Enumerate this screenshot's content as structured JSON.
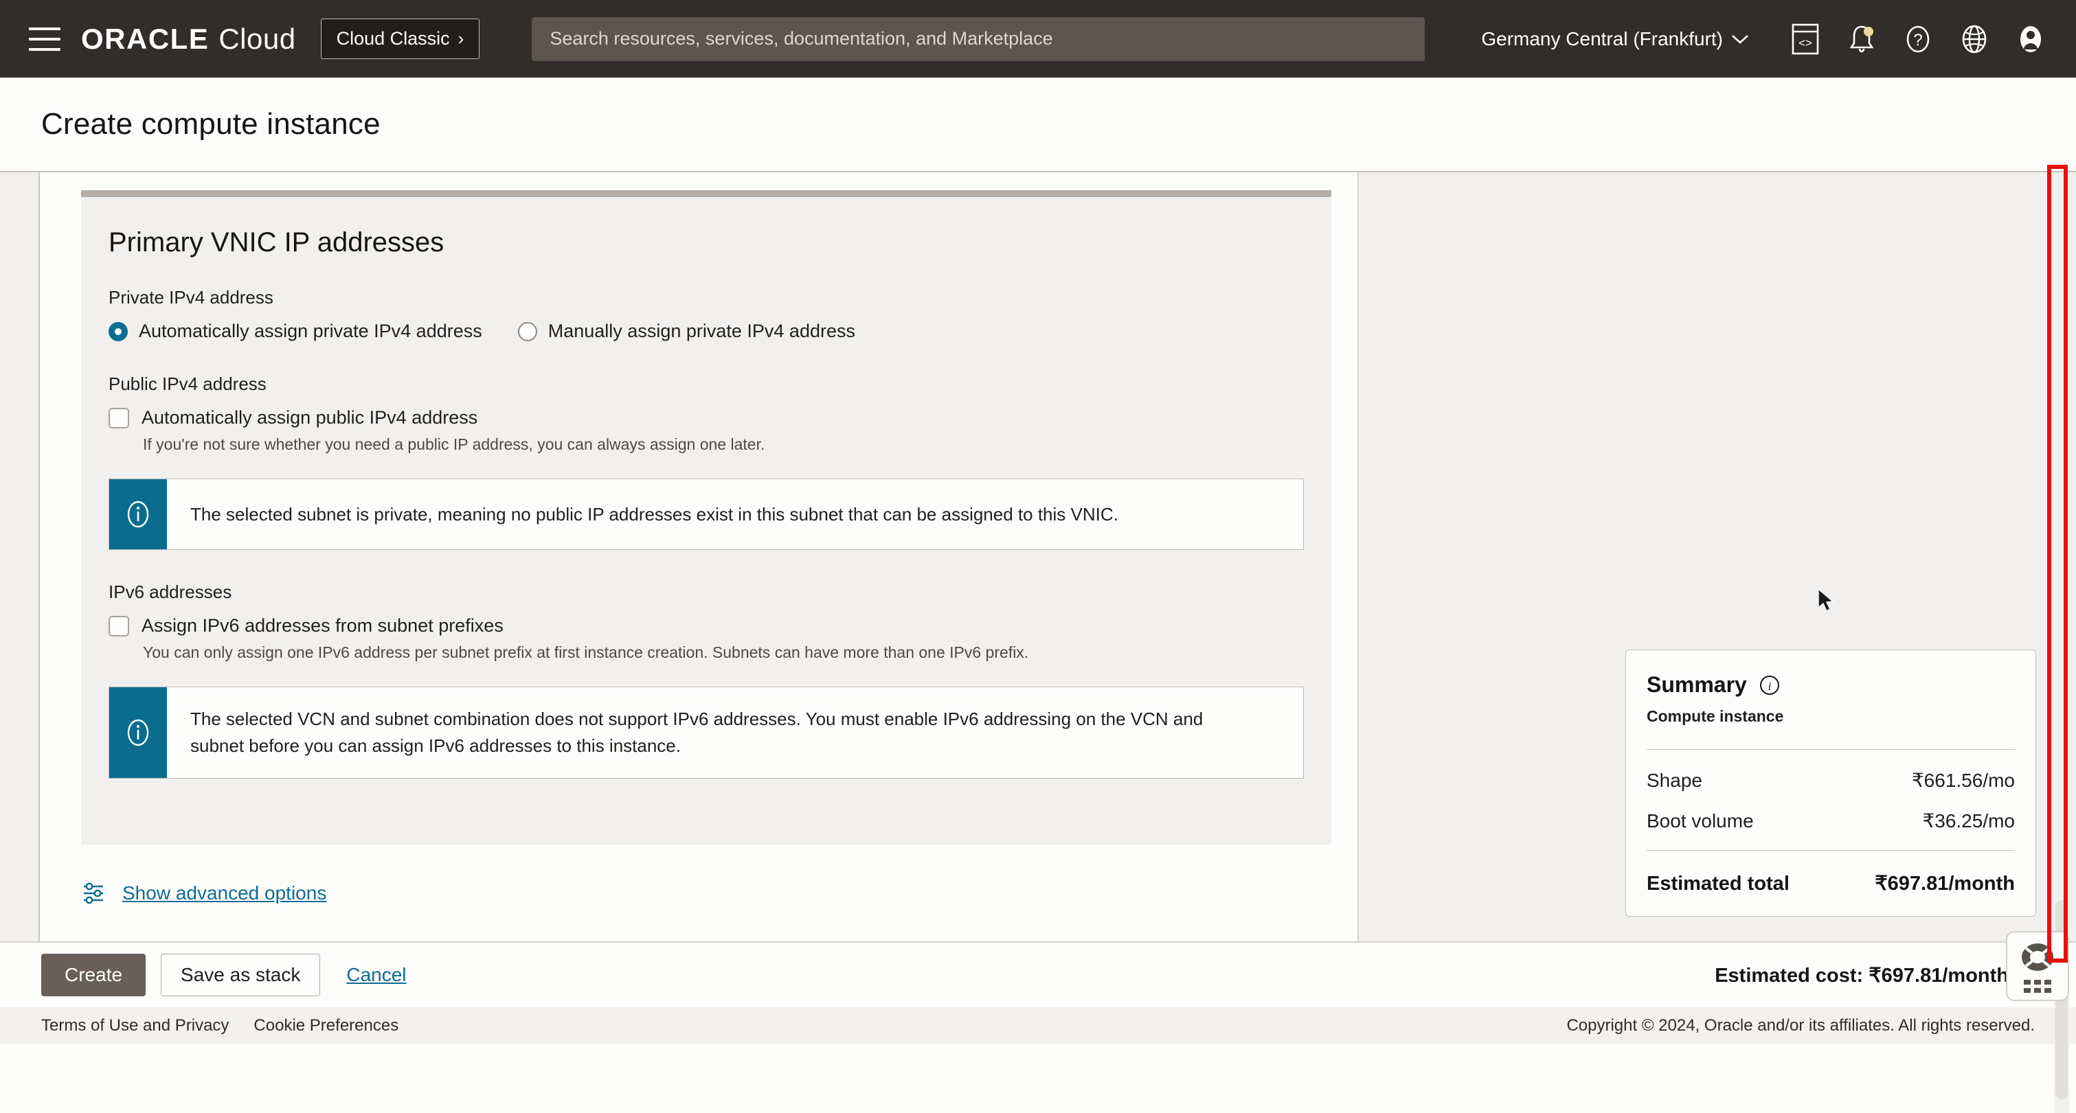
{
  "header": {
    "menu_icon": "hamburger-icon",
    "logo_oracle": "ORACLE",
    "logo_cloud": "Cloud",
    "cloud_classic_label": "Cloud Classic",
    "cloud_classic_chevron": "›",
    "search_placeholder": "Search resources, services, documentation, and Marketplace",
    "search_value": "",
    "region_label": "Germany Central (Frankfurt)",
    "region_chevron": "⌄",
    "icons": [
      "cloud-shell-icon",
      "notifications-bell-icon",
      "help-question-icon",
      "language-globe-icon",
      "user-avatar-icon"
    ],
    "notification_dot_color": "#f2d59a"
  },
  "page": {
    "title": "Create compute instance"
  },
  "form": {
    "section_title": "Primary VNIC IP addresses",
    "private_ipv4": {
      "label": "Private IPv4 address",
      "options": [
        {
          "label": "Automatically assign private IPv4 address",
          "selected": true
        },
        {
          "label": "Manually assign private IPv4 address",
          "selected": false
        }
      ]
    },
    "public_ipv4": {
      "label": "Public IPv4 address",
      "checkbox_label": "Automatically assign public IPv4 address",
      "checked": false,
      "help": "If you're not sure whether you need a public IP address, you can always assign one later."
    },
    "banner_public": {
      "icon": "info-circle-icon",
      "text": "The selected subnet is private, meaning no public IP addresses exist in this subnet that can be assigned to this VNIC."
    },
    "ipv6": {
      "label": "IPv6 addresses",
      "checkbox_label": "Assign IPv6 addresses from subnet prefixes",
      "checked": false,
      "help": "You can only assign one IPv6 address per subnet prefix at first instance creation. Subnets can have more than one IPv6 prefix."
    },
    "banner_ipv6": {
      "icon": "info-circle-icon",
      "text": "The selected VCN and subnet combination does not support IPv6 addresses. You must enable IPv6 addressing on the VCN and subnet before you can assign IPv6 addresses to this instance."
    },
    "advanced_link": {
      "icon": "sliders-icon",
      "label": "Show advanced options"
    }
  },
  "summary": {
    "title": "Summary",
    "info_icon": "info-circle-icon",
    "subtitle": "Compute instance",
    "rows": [
      {
        "label": "Shape",
        "value": "₹661.56/mo"
      },
      {
        "label": "Boot volume",
        "value": "₹36.25/mo"
      }
    ],
    "total_label": "Estimated total",
    "total_value": "₹697.81/month"
  },
  "help_widget": {
    "icon": "life-preserver-icon",
    "grip": "drag-grip-icon"
  },
  "actions": {
    "create_label": "Create",
    "save_stack_label": "Save as stack",
    "cancel_label": "Cancel",
    "estimated_cost_label": "Estimated cost: ₹697.81/month",
    "estimated_cost_chevron": "⌃"
  },
  "footer": {
    "terms_label": "Terms of Use and Privacy",
    "cookies_label": "Cookie Preferences",
    "copyright": "Copyright © 2024, Oracle and/or its affiliates. All rights reserved."
  },
  "annotation": {
    "type": "red-rectangle-highlight",
    "color": "#e90f0f"
  },
  "colors": {
    "topbar": "#312d2a",
    "accent_info": "#0a6c8e",
    "link": "#0f6c94",
    "primary_button": "#675f58"
  }
}
